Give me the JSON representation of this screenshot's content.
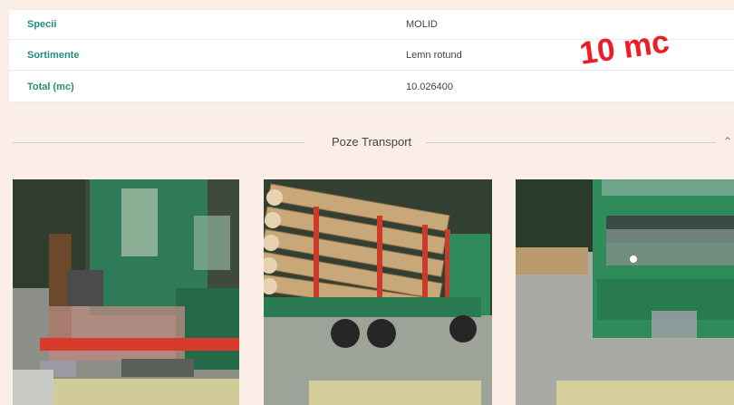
{
  "details": {
    "rows": [
      {
        "label": "Specii",
        "value": "MOLID"
      },
      {
        "label": "Sortimente",
        "value": "Lemn rotund"
      },
      {
        "label": "Total (mc)",
        "value": "10.026400"
      }
    ]
  },
  "annotation": "10 mc",
  "transport_section": {
    "title": "Poze Transport",
    "collapse_icon": "chevron-up-icon"
  },
  "photos": [
    {
      "name": "transport-photo-1",
      "subject": "truck-crane-loader"
    },
    {
      "name": "transport-photo-2",
      "subject": "logging-truck-loaded"
    },
    {
      "name": "transport-photo-3",
      "subject": "truck-front"
    }
  ],
  "colors": {
    "accent": "#1f8f7a",
    "annotation": "#ee1c24",
    "truck_green": "#2e8b57"
  }
}
